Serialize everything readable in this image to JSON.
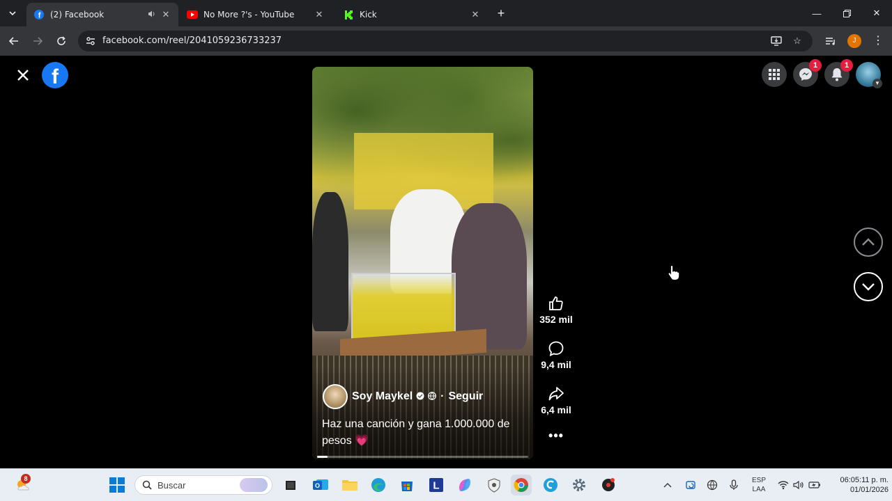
{
  "browser": {
    "tabs": [
      {
        "title": "(2) Facebook",
        "icon": "facebook-icon",
        "active": true
      },
      {
        "title": "No More ?'s - YouTube",
        "icon": "youtube-icon",
        "active": false
      },
      {
        "title": "Kick",
        "icon": "kick-icon",
        "active": false
      }
    ],
    "url": "facebook.com/reel/2041059236733237",
    "profile_initial": "J"
  },
  "facebook": {
    "messenger_badge": "1",
    "notifications_badge": "1"
  },
  "reel": {
    "author": "Soy Maykel",
    "follow_label": "Seguir",
    "separator": "·",
    "caption": "Haz una canción y gana 1.000.000 de pesos 💗",
    "progress": 0.05,
    "likes": "352 mil",
    "comments": "9,4 mil",
    "shares": "6,4 mil",
    "more": "•••"
  },
  "taskbar": {
    "search_placeholder": "Buscar",
    "weather_badge": "8",
    "lang_top": "ESP",
    "lang_bottom": "LAA",
    "time": "06:05:11 p. m.",
    "date": "01/01/2026"
  },
  "colors": {
    "facebook_blue": "#1877f2",
    "badge_red": "#e41e3f",
    "chrome_dark": "#202124",
    "chrome_toolbar": "#35363a"
  }
}
